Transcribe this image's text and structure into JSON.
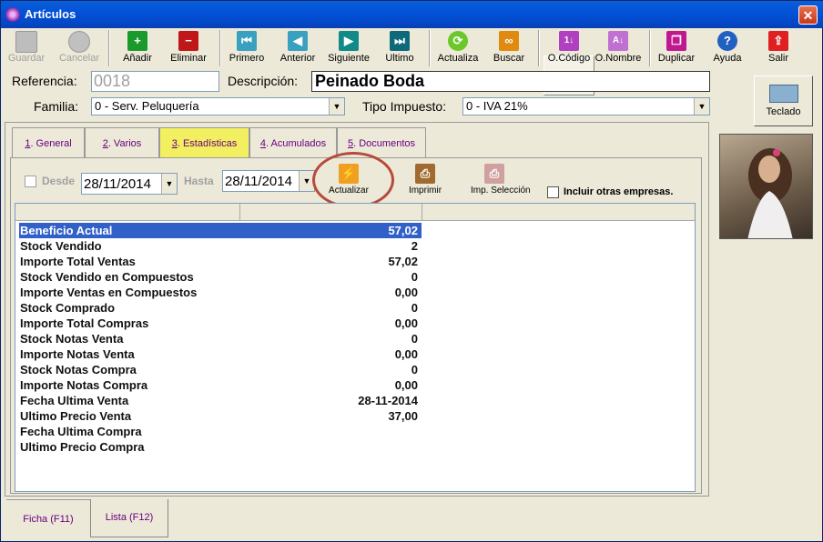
{
  "window": {
    "title": "Artículos",
    "close": "✕"
  },
  "toolbar": {
    "guardar": "Guardar",
    "cancelar": "Cancelar",
    "anadir": "Añadir",
    "eliminar": "Eliminar",
    "primero": "Primero",
    "anterior": "Anterior",
    "siguiente": "Siguiente",
    "ultimo": "Ultimo",
    "actualiza": "Actualiza",
    "buscar": "Buscar",
    "ocodigo": "O.Código",
    "onombre": "O.Nombre",
    "duplicar": "Duplicar",
    "ayuda": "Ayuda",
    "salir": "Salir"
  },
  "form": {
    "referencia_label": "Referencia:",
    "referencia_value": "0018",
    "descripcion_label": "Descripción:",
    "descripcion_value": "Peinado Boda",
    "familia_label": "Familia:",
    "familia_value": "0 - Serv. Peluquería",
    "tipo_label": "Tipo Impuesto:",
    "tipo_value": "0 - IVA 21%"
  },
  "teclado": "Teclado",
  "tabs": [
    {
      "num": "1",
      "label": ". General"
    },
    {
      "num": "2",
      "label": ". Varios"
    },
    {
      "num": "3",
      "label": ". Estadísticas"
    },
    {
      "num": "4",
      "label": ". Acumulados"
    },
    {
      "num": "5",
      "label": ". Documentos"
    }
  ],
  "filter": {
    "desde_label": "Desde",
    "desde_value": "28/11/2014",
    "hasta_label": "Hasta",
    "hasta_value": "28/11/2014",
    "actualizar": "Actualizar",
    "imprimir": "Imprimir",
    "imp_seleccion": "Imp. Selección",
    "incluir": "Incluir otras empresas."
  },
  "stats": [
    {
      "label": "Beneficio Actual",
      "value": "57,02"
    },
    {
      "label": "Stock Vendido",
      "value": "2"
    },
    {
      "label": "Importe Total Ventas",
      "value": "57,02"
    },
    {
      "label": "Stock Vendido en Compuestos",
      "value": "0"
    },
    {
      "label": "Importe Ventas en Compuestos",
      "value": "0,00"
    },
    {
      "label": "Stock Comprado",
      "value": "0"
    },
    {
      "label": "Importe Total Compras",
      "value": "0,00"
    },
    {
      "label": "Stock Notas Venta",
      "value": "0"
    },
    {
      "label": "Importe Notas Venta",
      "value": "0,00"
    },
    {
      "label": "Stock Notas Compra",
      "value": "0"
    },
    {
      "label": "Importe Notas Compra",
      "value": "0,00"
    },
    {
      "label": "Fecha Ultima Venta",
      "value": "28-11-2014"
    },
    {
      "label": "Ultimo Precio Venta",
      "value": "37,00"
    },
    {
      "label": "Fecha Ultima Compra",
      "value": ""
    },
    {
      "label": "Ultimo Precio Compra",
      "value": ""
    }
  ],
  "bottom_tabs": {
    "ficha": "Ficha (F11)",
    "lista": "Lista (F12)"
  },
  "colors": {
    "selection": "#3160c8",
    "active_tab": "#f2f060",
    "highlight_ring": "#b84a3c"
  }
}
